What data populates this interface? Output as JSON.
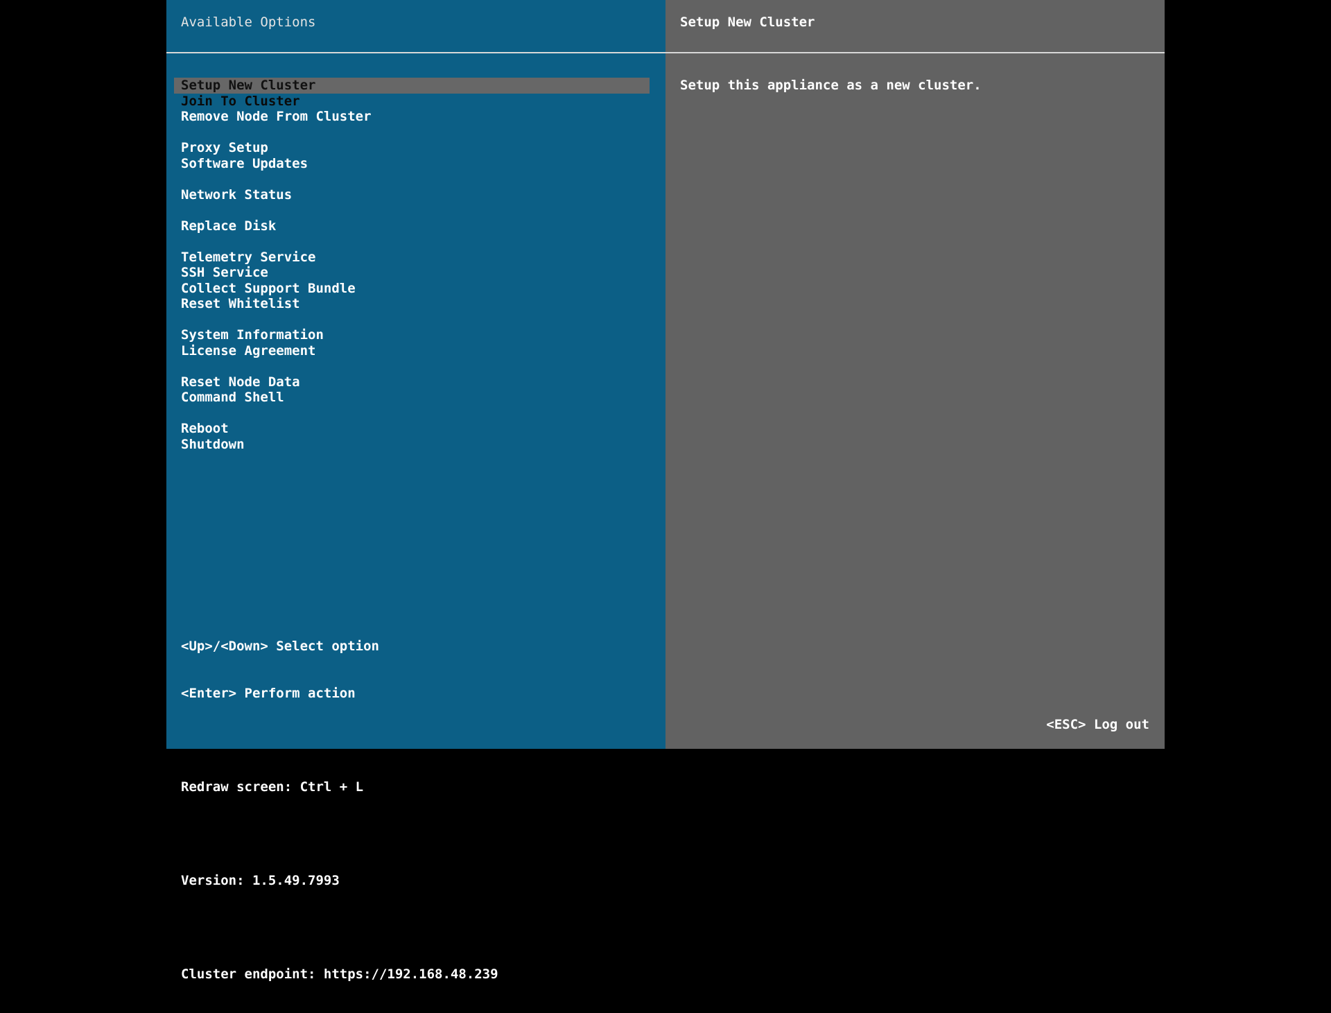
{
  "left_pane": {
    "title": "Available Options",
    "menu_groups": [
      [
        "Setup New Cluster",
        "Join To Cluster",
        "Remove Node From Cluster"
      ],
      [
        "Proxy Setup",
        "Software Updates"
      ],
      [
        "Network Status"
      ],
      [
        "Replace Disk"
      ],
      [
        "Telemetry Service",
        "SSH Service",
        "Collect Support Bundle",
        "Reset Whitelist"
      ],
      [
        "System Information",
        "License Agreement"
      ],
      [
        "Reset Node Data",
        "Command Shell"
      ],
      [
        "Reboot",
        "Shutdown"
      ]
    ],
    "selected_item": "Setup New Cluster",
    "help": {
      "navigate": "<Up>/<Down> Select option",
      "perform": "<Enter> Perform action",
      "redraw": "Redraw screen: Ctrl + L",
      "version": "Version: 1.5.49.7993",
      "endpoint": "Cluster endpoint: https://192.168.48.239"
    }
  },
  "right_pane": {
    "title": "Setup New Cluster",
    "description": "Setup this appliance as a new cluster.",
    "logout": "<ESC> Log out"
  },
  "colors": {
    "left_bg": "#0c5f86",
    "right_bg": "#626262",
    "selection_bg": "#676767",
    "outer_bg": "#000000"
  }
}
